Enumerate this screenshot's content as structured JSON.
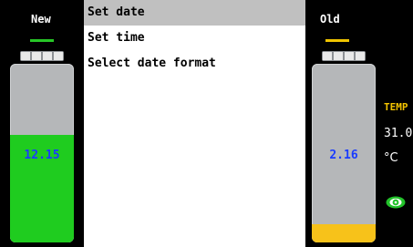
{
  "left_battery": {
    "title": "New",
    "value": "12.15",
    "level_fraction": 0.6,
    "line_color": "#27c627",
    "fill_color": "#1fcc1f",
    "value_color": "#1a3cff"
  },
  "menu": {
    "items": [
      {
        "label": "Set date",
        "selected": true
      },
      {
        "label": "Set time",
        "selected": false
      },
      {
        "label": "Select date format",
        "selected": false
      }
    ]
  },
  "right_battery": {
    "title": "Old",
    "value": "2.16",
    "level_fraction": 0.1,
    "line_color": "#f0c400",
    "fill_color": "#f7c21a",
    "value_color": "#1a3cff"
  },
  "temperature": {
    "label": "TEMP",
    "value": "31.0",
    "unit": "°C"
  },
  "icons": {
    "status": "eye-icon"
  },
  "colors": {
    "menu_selected_bg": "#c0c0c0",
    "accent_temp": "#f4c400",
    "status_icon": "#22c22a"
  }
}
